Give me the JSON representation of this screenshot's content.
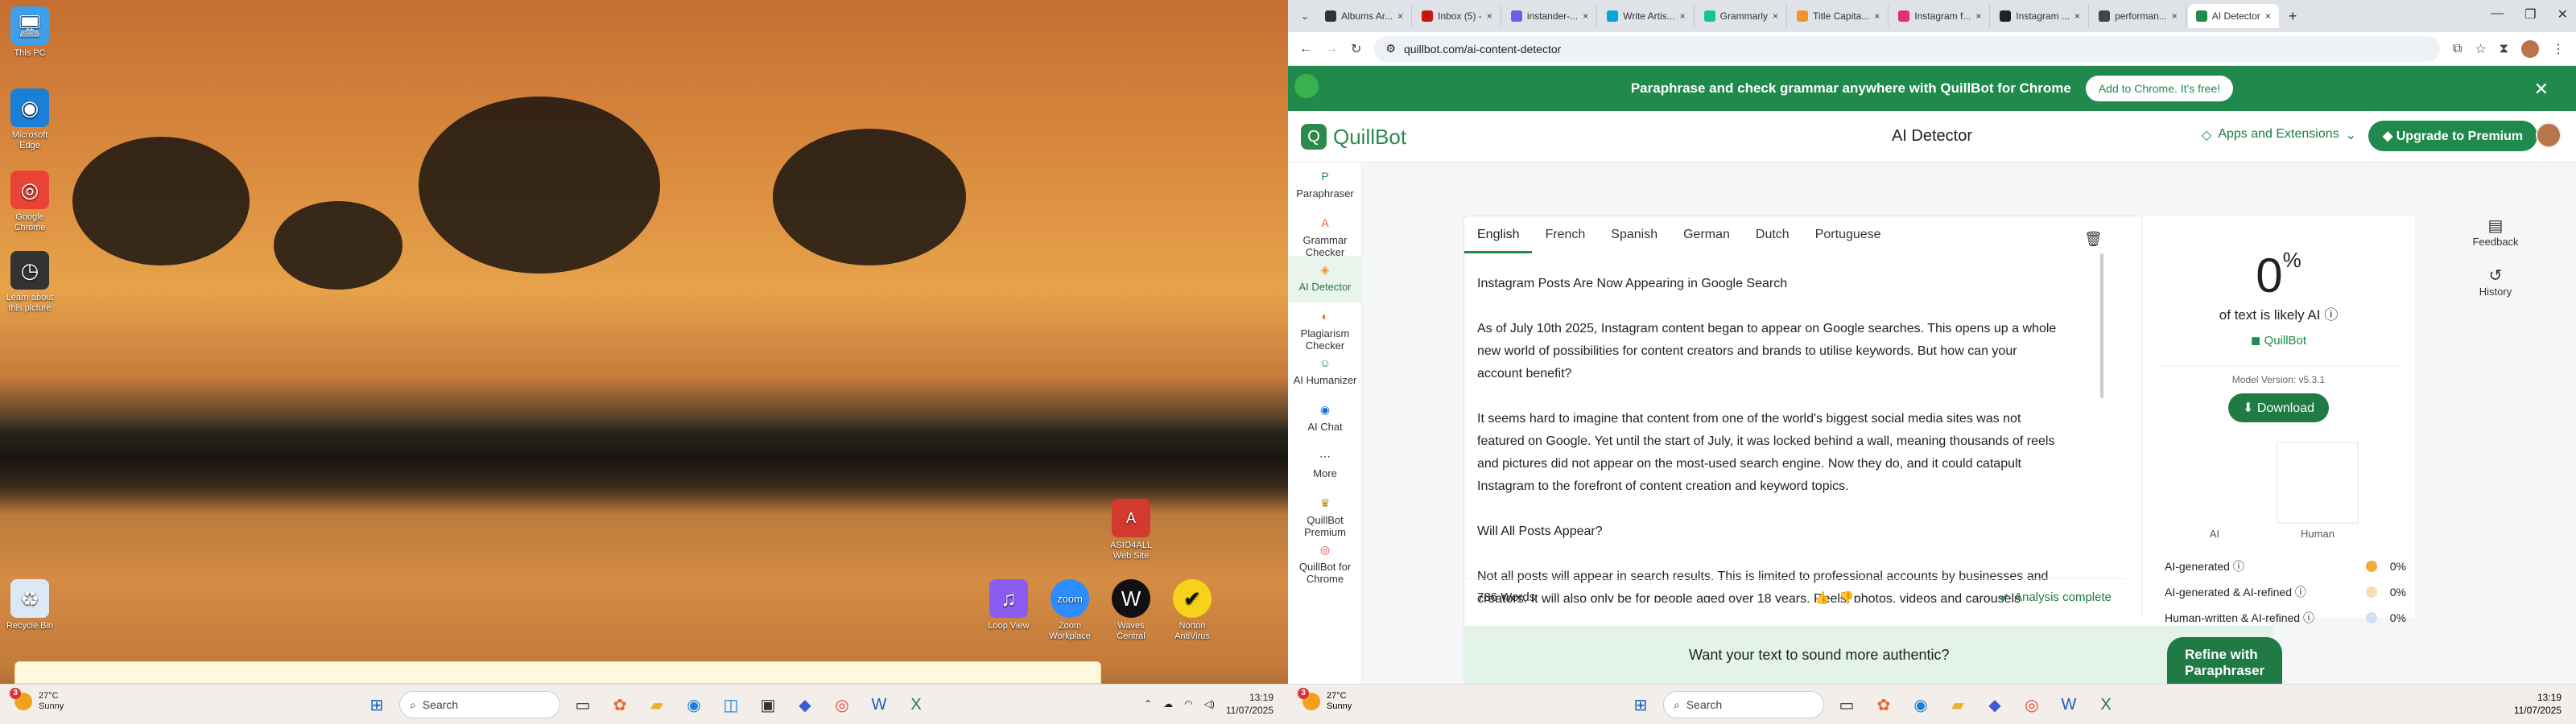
{
  "left_desktop": {
    "icons": [
      {
        "label": "This PC",
        "color": "#3ea0e8",
        "glyph": "🖥"
      },
      {
        "label": "Microsoft Edge",
        "color": "#1a7fd6",
        "glyph": "◉"
      },
      {
        "label": "Google Chrome",
        "color": "#e94335",
        "glyph": "◎"
      },
      {
        "label": "Learn about this picture",
        "color": "#333333",
        "glyph": "◷"
      },
      {
        "label": "Recycle Bin",
        "color": "#dbe8f6",
        "glyph": "♻"
      }
    ],
    "right_icons": [
      {
        "label": "ASIO4ALL Web Site",
        "color": "#d23a2f",
        "glyph": "A"
      },
      {
        "label": "Loop View",
        "color": "#8a5cf0",
        "glyph": "♫"
      },
      {
        "label": "Zoom Workplace",
        "color": "#2d8cff",
        "glyph": "zoom"
      },
      {
        "label": "Waves Central",
        "color": "#111111",
        "glyph": "W"
      },
      {
        "label": "Norton AntiVirus",
        "color": "#f7d21b",
        "glyph": "✔"
      }
    ]
  },
  "taskbar": {
    "weather_temp": "27°C",
    "weather_cond": "Sunny",
    "weather_badge": "3",
    "search_placeholder": "Search",
    "time": "13:19",
    "date": "11/07/2025"
  },
  "browser": {
    "tabs": [
      {
        "title": "Albums Ar...",
        "color": "#333"
      },
      {
        "title": "Inbox (5) -",
        "color": "#c71610"
      },
      {
        "title": "instander-...",
        "color": "#6c5ce7"
      },
      {
        "title": "Write Artis...",
        "color": "#00a7d6"
      },
      {
        "title": "Grammarly",
        "color": "#15c39a"
      },
      {
        "title": "Title Capita...",
        "color": "#f0932b"
      },
      {
        "title": "Instagram f...",
        "color": "#e1306c"
      },
      {
        "title": "Instagram ...",
        "color": "#222"
      },
      {
        "title": "performan...",
        "color": "#444"
      },
      {
        "title": "AI Detector",
        "color": "#1f8a4c"
      }
    ],
    "url": "quillbot.com/ai-content-detector"
  },
  "promo": {
    "text": "Paraphrase and check grammar anywhere with QuillBot for Chrome",
    "button": "Add to Chrome. It's free!"
  },
  "header": {
    "logo": "QuillBot",
    "title": "AI Detector",
    "apps": "Apps and Extensions",
    "upgrade": "Upgrade to Premium"
  },
  "sidenav": [
    {
      "label": "Paraphraser",
      "color": "#2c8a4a",
      "glyph": "P"
    },
    {
      "label": "Grammar Checker",
      "color": "#e8613c",
      "glyph": "A"
    },
    {
      "label": "AI Detector",
      "color": "#f0932b",
      "glyph": "◈"
    },
    {
      "label": "Plagiarism Checker",
      "color": "#e8613c",
      "glyph": "◐"
    },
    {
      "label": "AI Humanizer",
      "color": "#2c8a4a",
      "glyph": "☺"
    },
    {
      "label": "AI Chat",
      "color": "#1a6fd6",
      "glyph": "◉"
    },
    {
      "label": "More",
      "color": "#333",
      "glyph": "⋯"
    },
    {
      "label": "QuillBot Premium",
      "color": "#b8860b",
      "glyph": "♛"
    },
    {
      "label": "QuillBot for Chrome",
      "color": "#e94335",
      "glyph": "◎"
    }
  ],
  "editor": {
    "langs": [
      "English",
      "French",
      "Spanish",
      "German",
      "Dutch",
      "Portuguese"
    ],
    "paragraphs": [
      "Instagram Posts Are Now Appearing in Google Search",
      "As of July 10th 2025, Instagram content began to appear on Google searches. This opens up a whole new world of possibilities for content creators and brands to utilise keywords. But how can your account benefit?",
      "It seems hard to imagine that content from one of the world's biggest social media sites was not featured on Google. Yet until the start of July, it was locked behind a wall, meaning thousands of reels and pictures did not appear on the most-used search engine. Now they do, and it could catapult Instagram to the forefront of content creation and keyword topics.",
      "Will All Posts Appear?",
      "Not all posts will appear in search results. This is limited to professional accounts by businesses and creators. It will also only be for people aged over 18 years. Reels, photos, videos and carousels"
    ],
    "word_count": "786 Words",
    "status": "Analysis complete"
  },
  "results": {
    "percent": "0",
    "likely": "of text is likely AI",
    "brand": "QuillBot",
    "model": "Model Version: v5.3.1",
    "download": "Download",
    "axis_ai": "AI",
    "axis_human": "Human",
    "legend": [
      {
        "label": "AI-generated",
        "value": "0%",
        "color": "#f3a93a"
      },
      {
        "label": "AI-generated & AI-refined",
        "value": "0%",
        "color": "#f6deb0"
      },
      {
        "label": "Human-written & AI-refined",
        "value": "0%",
        "color": "#cfe0f7"
      }
    ]
  },
  "refine": {
    "prompt": "Want your text to sound more authentic?",
    "button": "Refine with Paraphraser"
  },
  "right_rail": [
    "Feedback",
    "History"
  ]
}
